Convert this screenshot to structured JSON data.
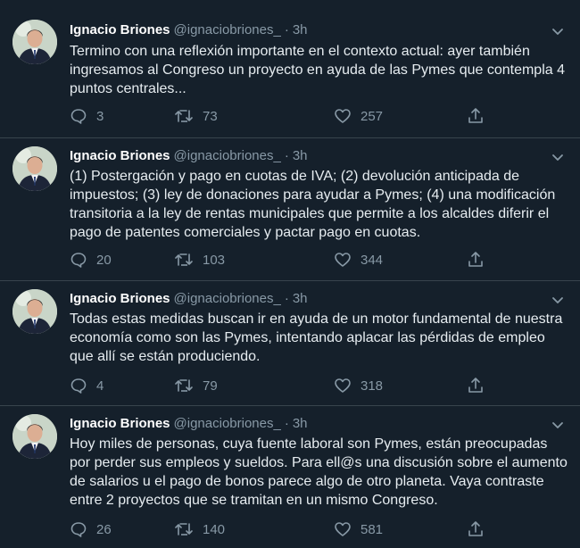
{
  "tweets": [
    {
      "name": "Ignacio Briones",
      "handle": "@ignaciobriones_",
      "sep": "·",
      "time": "3h",
      "text": "Termino con una reflexión importante en el contexto actual: ayer también ingresamos al Congreso un proyecto en ayuda de las Pymes que contempla 4 puntos centrales...",
      "replies": "3",
      "retweets": "73",
      "likes": "257"
    },
    {
      "name": "Ignacio Briones",
      "handle": "@ignaciobriones_",
      "sep": "·",
      "time": "3h",
      "text": "(1) Postergación y pago en cuotas de IVA; (2) devolución anticipada de impuestos; (3) ley de donaciones para ayudar a Pymes; (4) una modificación transitoria a la ley de rentas municipales que permite a los alcaldes diferir el pago de patentes comerciales y pactar pago en cuotas.",
      "replies": "20",
      "retweets": "103",
      "likes": "344"
    },
    {
      "name": "Ignacio Briones",
      "handle": "@ignaciobriones_",
      "sep": "·",
      "time": "3h",
      "text": "Todas estas medidas buscan ir en ayuda de un motor fundamental de nuestra economía como son las Pymes, intentando aplacar las pérdidas de empleo que allí se están produciendo.",
      "replies": "4",
      "retweets": "79",
      "likes": "318"
    },
    {
      "name": "Ignacio Briones",
      "handle": "@ignaciobriones_",
      "sep": "·",
      "time": "3h",
      "text": "Hoy miles de personas, cuya fuente laboral son Pymes, están preocupadas por perder sus empleos y sueldos. Para ell@s una discusión sobre el aumento de salarios u el pago de bonos parece algo de otro planeta. Vaya contraste entre 2 proyectos que se tramitan en un mismo Congreso.",
      "replies": "26",
      "retweets": "140",
      "likes": "581"
    }
  ],
  "icons": {
    "reply": "reply-icon",
    "retweet": "retweet-icon",
    "like": "heart-icon",
    "share": "share-icon",
    "menu": "chevron-down-icon"
  },
  "colors": {
    "background": "#15202b",
    "muted": "#8899a6",
    "divider": "#38444d"
  }
}
